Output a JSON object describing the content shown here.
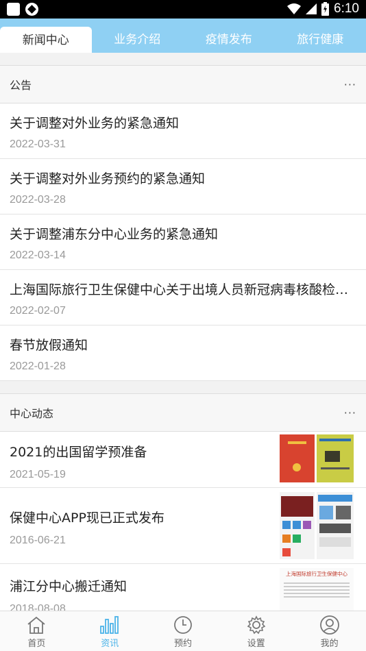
{
  "status_bar": {
    "time": "6:10"
  },
  "tabs": [
    {
      "label": "新闻中心",
      "active": true
    },
    {
      "label": "业务介绍",
      "active": false
    },
    {
      "label": "疫情发布",
      "active": false
    },
    {
      "label": "旅行健康",
      "active": false
    }
  ],
  "announcements": {
    "title": "公告",
    "more": "···",
    "items": [
      {
        "title": "关于调整对外业务的紧急通知",
        "date": "2022-03-31"
      },
      {
        "title": "关于调整对外业务预约的紧急通知",
        "date": "2022-03-28"
      },
      {
        "title": "关于调整浦东分中心业务的紧急通知",
        "date": "2022-03-14"
      },
      {
        "title": "上海国际旅行卫生保健中心关于出境人员新冠病毒核酸检…",
        "date": "2022-02-07"
      },
      {
        "title": "春节放假通知",
        "date": "2022-01-28"
      }
    ]
  },
  "news": {
    "title": "中心动态",
    "more": "···",
    "items": [
      {
        "title": "2021的出国留学预准备",
        "date": "2021-05-19"
      },
      {
        "title": "保健中心APP现已正式发布",
        "date": "2016-06-21"
      },
      {
        "title": "浦江分中心搬迁通知",
        "date": "2018-08-08",
        "thumb_heading": "上海国际旅行卫生保健中心"
      }
    ]
  },
  "bottom_nav": [
    {
      "label": "首页",
      "icon": "home-icon",
      "active": false
    },
    {
      "label": "资讯",
      "icon": "bar-chart-icon",
      "active": true
    },
    {
      "label": "预约",
      "icon": "clock-icon",
      "active": false
    },
    {
      "label": "设置",
      "icon": "gear-icon",
      "active": false
    },
    {
      "label": "我的",
      "icon": "user-icon",
      "active": false
    }
  ],
  "colors": {
    "accent": "#4bb3e8",
    "tab_bar": "#8fd0f3",
    "date": "#999999"
  }
}
